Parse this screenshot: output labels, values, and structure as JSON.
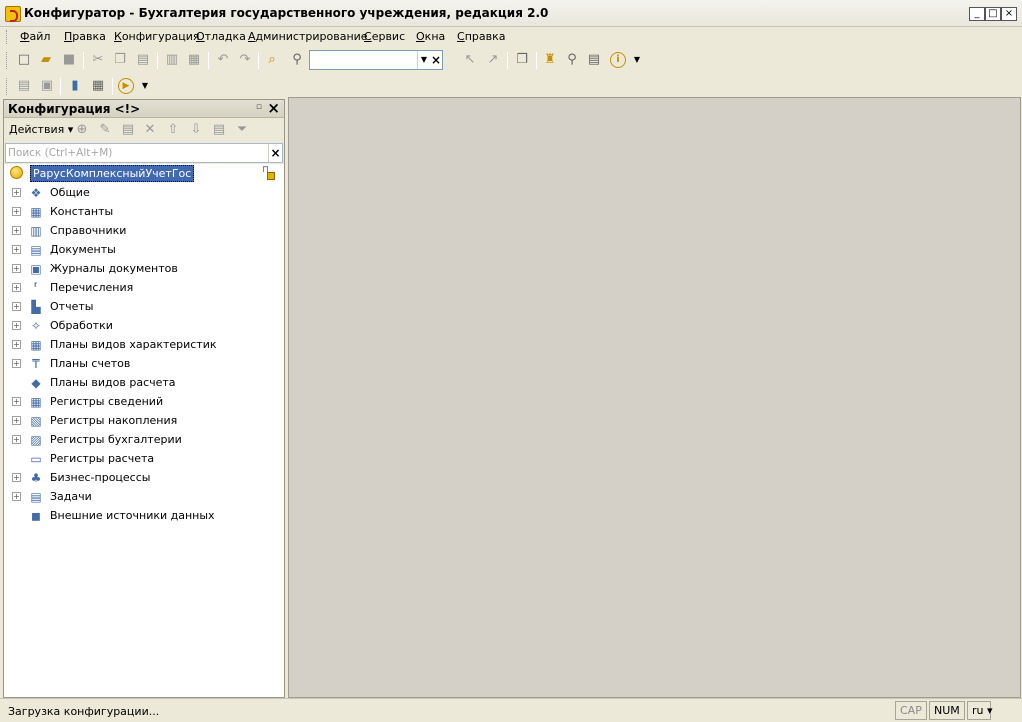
{
  "window": {
    "title": "Конфигуратор - Бухгалтерия государственного учреждения, редакция 2.0",
    "min_glyph": "_",
    "max_glyph": "□",
    "close_glyph": "×"
  },
  "menubar": {
    "items": [
      {
        "accel": "Ф",
        "rest": "айл"
      },
      {
        "accel": "П",
        "rest": "равка"
      },
      {
        "accel": "К",
        "rest": "онфигурация"
      },
      {
        "accel": "О",
        "rest": "тладка"
      },
      {
        "accel": "А",
        "rest": "дминистрирование"
      },
      {
        "accel": "С",
        "rest": "ервис"
      },
      {
        "accel": "О",
        "rest": "кна"
      },
      {
        "accel": "С",
        "rest": "правка"
      }
    ]
  },
  "toolbar": {
    "search_value": "",
    "search_dropdown_glyph": "▼",
    "search_clear_glyph": "×",
    "info_glyph": "i"
  },
  "panel": {
    "title": "Конфигурация <!>",
    "pin_glyph": "▫",
    "close_glyph": "×",
    "actions_label": "Действия ▾",
    "filter_placeholder": "Поиск (Ctrl+Alt+M)",
    "filter_clear_glyph": "×"
  },
  "tree": {
    "root": "РарусКомплексныйУчетГос",
    "items": [
      {
        "label": "Общие",
        "icon": "common-icon",
        "expandable": true
      },
      {
        "label": "Константы",
        "icon": "constants-icon",
        "expandable": true
      },
      {
        "label": "Справочники",
        "icon": "catalogs-icon",
        "expandable": true
      },
      {
        "label": "Документы",
        "icon": "documents-icon",
        "expandable": true
      },
      {
        "label": "Журналы документов",
        "icon": "journals-icon",
        "expandable": true
      },
      {
        "label": "Перечисления",
        "icon": "enums-icon",
        "expandable": true
      },
      {
        "label": "Отчеты",
        "icon": "reports-icon",
        "expandable": true
      },
      {
        "label": "Обработки",
        "icon": "processing-icon",
        "expandable": true
      },
      {
        "label": "Планы видов характеристик",
        "icon": "characteristic-plans-icon",
        "expandable": true
      },
      {
        "label": "Планы счетов",
        "icon": "account-plans-icon",
        "expandable": true
      },
      {
        "label": "Планы видов расчета",
        "icon": "calculation-plans-icon",
        "expandable": false
      },
      {
        "label": "Регистры сведений",
        "icon": "info-registers-icon",
        "expandable": true
      },
      {
        "label": "Регистры накопления",
        "icon": "accumulation-registers-icon",
        "expandable": true
      },
      {
        "label": "Регистры бухгалтерии",
        "icon": "accounting-registers-icon",
        "expandable": true
      },
      {
        "label": "Регистры расчета",
        "icon": "calculation-registers-icon",
        "expandable": false
      },
      {
        "label": "Бизнес-процессы",
        "icon": "business-processes-icon",
        "expandable": true
      },
      {
        "label": "Задачи",
        "icon": "tasks-icon",
        "expandable": true
      },
      {
        "label": "Внешние источники данных",
        "icon": "external-sources-icon",
        "expandable": false
      }
    ],
    "expand_glyph": "+"
  },
  "statusbar": {
    "text": "Загрузка конфигурации...",
    "cap": "CAP",
    "num": "NUM",
    "lang": "ru ▾"
  }
}
